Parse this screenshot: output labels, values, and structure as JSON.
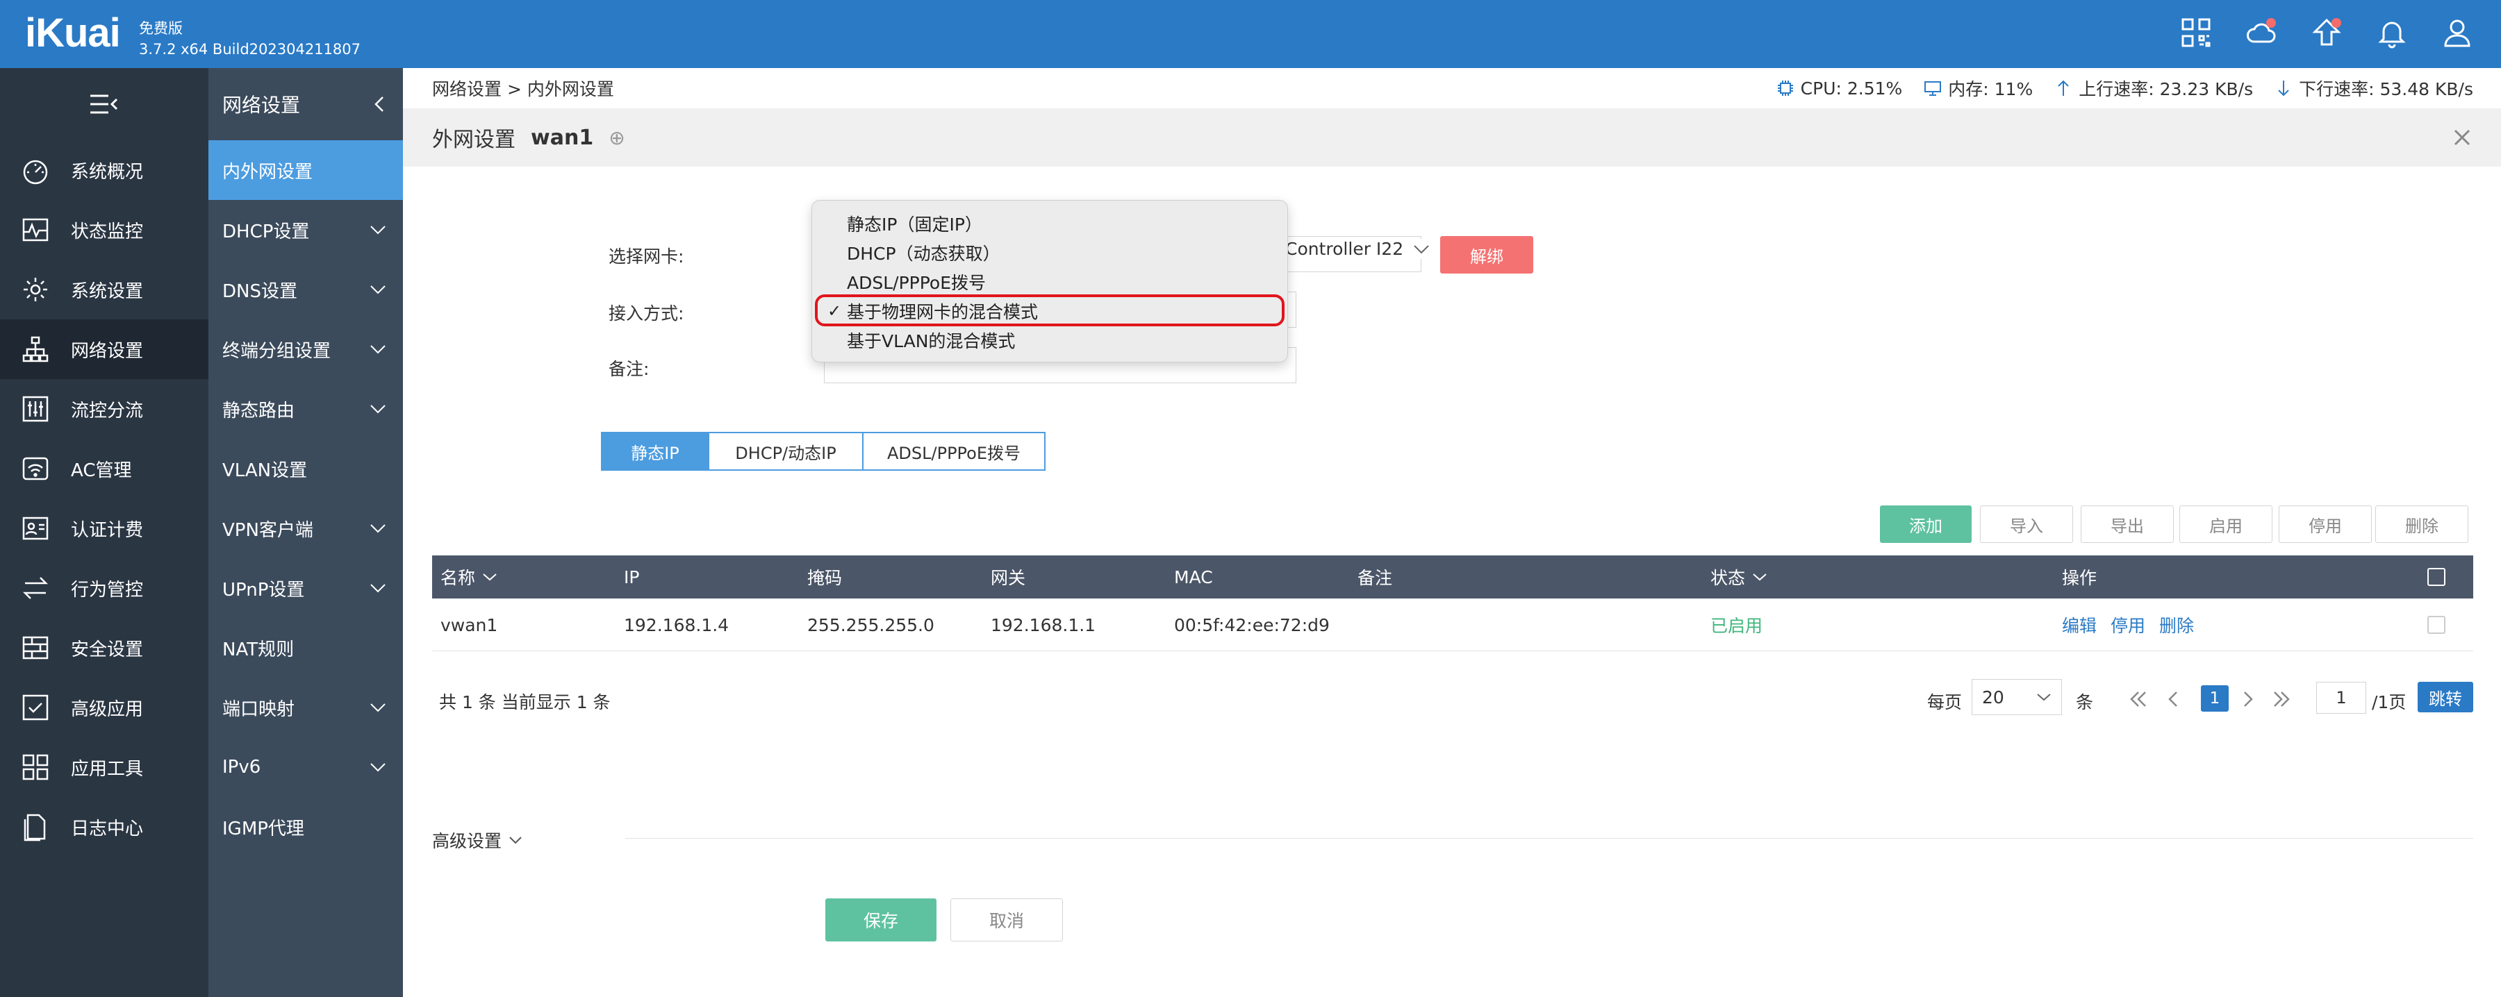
{
  "brand": {
    "logo": "iKuai",
    "edition": "免费版",
    "version": "3.7.2 x64 Build202304211807"
  },
  "topbar": {
    "icons": [
      "grid-icon",
      "cloud-icon",
      "upgrade-icon",
      "bell-icon",
      "user-icon"
    ]
  },
  "nav": {
    "items": [
      {
        "label": "系统概况",
        "icon": "speedometer-icon"
      },
      {
        "label": "状态监控",
        "icon": "pulse-icon"
      },
      {
        "label": "系统设置",
        "icon": "gear-icon"
      },
      {
        "label": "网络设置",
        "icon": "network-icon"
      },
      {
        "label": "流控分流",
        "icon": "sliders-icon"
      },
      {
        "label": "AC管理",
        "icon": "wifi-icon"
      },
      {
        "label": "认证计费",
        "icon": "id-card-icon"
      },
      {
        "label": "行为管控",
        "icon": "arrows-icon"
      },
      {
        "label": "安全设置",
        "icon": "firewall-icon"
      },
      {
        "label": "高级应用",
        "icon": "checkbox-icon"
      },
      {
        "label": "应用工具",
        "icon": "apps-icon"
      },
      {
        "label": "日志中心",
        "icon": "document-icon"
      }
    ],
    "active_index": 3
  },
  "subnav": {
    "title": "网络设置",
    "items": [
      {
        "label": "内外网设置",
        "chevron": false
      },
      {
        "label": "DHCP设置",
        "chevron": true
      },
      {
        "label": "DNS设置",
        "chevron": true
      },
      {
        "label": "终端分组设置",
        "chevron": true
      },
      {
        "label": "静态路由",
        "chevron": true
      },
      {
        "label": "VLAN设置",
        "chevron": false
      },
      {
        "label": "VPN客户端",
        "chevron": true
      },
      {
        "label": "UPnP设置",
        "chevron": true
      },
      {
        "label": "NAT规则",
        "chevron": false
      },
      {
        "label": "端口映射",
        "chevron": true
      },
      {
        "label": "IPv6",
        "chevron": true
      },
      {
        "label": "IGMP代理",
        "chevron": false
      }
    ]
  },
  "status": {
    "breadcrumb": "网络设置 > 内外网设置",
    "cpu": "CPU: 2.51%",
    "memory": "内存: 11%",
    "upload": "上行速率: 23.23 KB/s",
    "download": "下行速率: 53.48 KB/s"
  },
  "page": {
    "title": "外网设置",
    "wan": "wan1",
    "plus": "⊕"
  },
  "form": {
    "nic_label": "选择网卡:",
    "nic_value_tail": "Controller I22",
    "unbind": "解绑",
    "access_label": "接入方式:",
    "remark_label": "备注:"
  },
  "dropdown": {
    "options": [
      "静态IP（固定IP）",
      "DHCP（动态获取）",
      "ADSL/PPPoE拨号",
      "基于物理网卡的混合模式",
      "基于VLAN的混合模式"
    ],
    "selected_index": 3,
    "check": "✓"
  },
  "tabs": {
    "items": [
      "静态IP",
      "DHCP/动态IP",
      "ADSL/PPPoE拨号"
    ],
    "active_index": 0
  },
  "toolbar": {
    "add": "添加",
    "import": "导入",
    "export": "导出",
    "enable": "启用",
    "disable": "停用",
    "delete": "删除"
  },
  "table": {
    "headers": {
      "name": "名称",
      "ip": "IP",
      "mask": "掩码",
      "gateway": "网关",
      "mac": "MAC",
      "remark": "备注",
      "status": "状态",
      "ops": "操作"
    },
    "rows": [
      {
        "name": "vwan1",
        "ip": "192.168.1.4",
        "mask": "255.255.255.0",
        "gateway": "192.168.1.1",
        "mac": "00:5f:42:ee:72:d9",
        "remark": "",
        "status": "已启用",
        "edit": "编辑",
        "disable": "停用",
        "delete": "删除"
      }
    ]
  },
  "pager": {
    "summary": "共 1 条 当前显示 1 条",
    "per_page_label": "每页",
    "per_page": "20",
    "unit": "条",
    "current": "1",
    "goto_value": "1",
    "total_pages": "/1页",
    "jump": "跳转"
  },
  "advanced": {
    "label": "高级设置"
  },
  "actions": {
    "save": "保存",
    "cancel": "取消"
  },
  "colors": {
    "topbar": "#2a7ac6",
    "nav": "#2b3643",
    "subnav": "#3c4b5c",
    "accent": "#4c9ce0",
    "green": "#5ec2a0",
    "danger": "#f57272",
    "highlight": "#e0161c"
  }
}
